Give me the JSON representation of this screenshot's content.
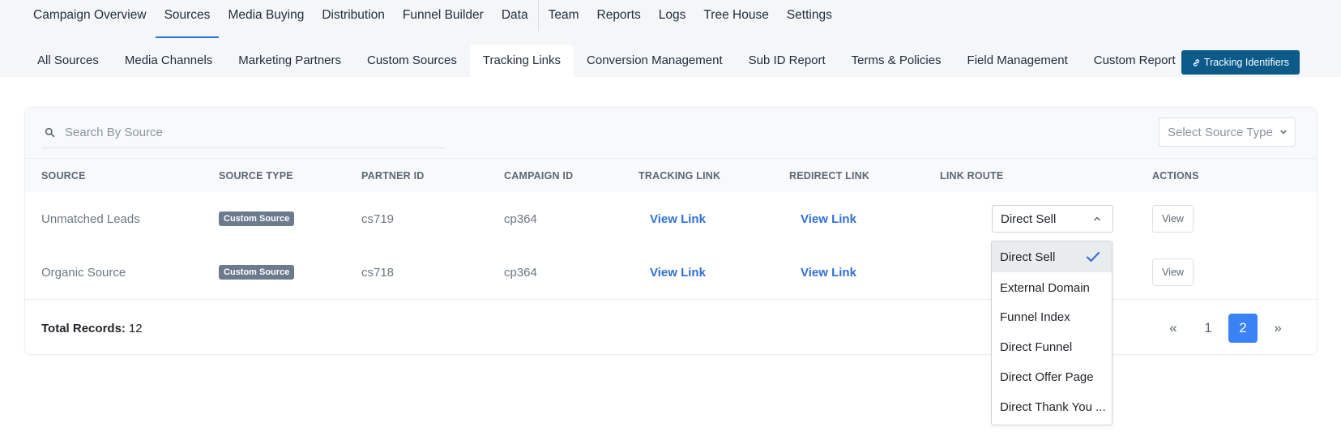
{
  "main_nav": [
    {
      "label": "Campaign Overview"
    },
    {
      "label": "Sources",
      "active": true
    },
    {
      "label": "Media Buying"
    },
    {
      "label": "Distribution"
    },
    {
      "label": "Funnel Builder"
    },
    {
      "label": "Data"
    },
    {
      "label": "Team"
    },
    {
      "label": "Reports"
    },
    {
      "label": "Logs"
    },
    {
      "label": "Tree House"
    },
    {
      "label": "Settings"
    }
  ],
  "sub_nav": [
    {
      "label": "All Sources"
    },
    {
      "label": "Media Channels"
    },
    {
      "label": "Marketing Partners"
    },
    {
      "label": "Custom Sources"
    },
    {
      "label": "Tracking Links",
      "active": true
    },
    {
      "label": "Conversion Management"
    },
    {
      "label": "Sub ID Report"
    },
    {
      "label": "Terms & Policies"
    },
    {
      "label": "Field Management"
    },
    {
      "label": "Custom Report"
    }
  ],
  "tracking_button": {
    "label": "Tracking Identifiers",
    "icon": "link-icon",
    "color": "#0b5a8a"
  },
  "search": {
    "placeholder": "Search By Source",
    "value": ""
  },
  "source_type_select": {
    "placeholder": "Select Source Type"
  },
  "table": {
    "headers": [
      "SOURCE",
      "SOURCE TYPE",
      "PARTNER ID",
      "CAMPAIGN ID",
      "TRACKING LINK",
      "REDIRECT LINK",
      "LINK ROUTE",
      "ACTIONS"
    ],
    "rows": [
      {
        "source": "Unmatched Leads",
        "source_type": "Custom Source",
        "partner_id": "cs719",
        "campaign_id": "cp364",
        "tracking_link": "View Link",
        "redirect_link": "View Link",
        "link_route": "Direct Sell",
        "action": "View"
      },
      {
        "source": "Organic Source",
        "source_type": "Custom Source",
        "partner_id": "cs718",
        "campaign_id": "cp364",
        "tracking_link": "View Link",
        "redirect_link": "View Link",
        "link_route": "",
        "action": "View"
      }
    ]
  },
  "footer": {
    "total_label": "Total Records:",
    "total_value": "12"
  },
  "pagination": {
    "prev": "«",
    "pages": [
      "1",
      "2"
    ],
    "current": "2",
    "next": "»"
  },
  "link_route_dropdown": {
    "options": [
      "Direct Sell",
      "External Domain",
      "Funnel Index",
      "Direct Funnel",
      "Direct Offer Page",
      "Direct Thank You ..."
    ],
    "selected": "Direct Sell"
  },
  "colors": {
    "accent": "#3b82f6",
    "link": "#2f6fd8",
    "badge": "#6c7a8d"
  }
}
